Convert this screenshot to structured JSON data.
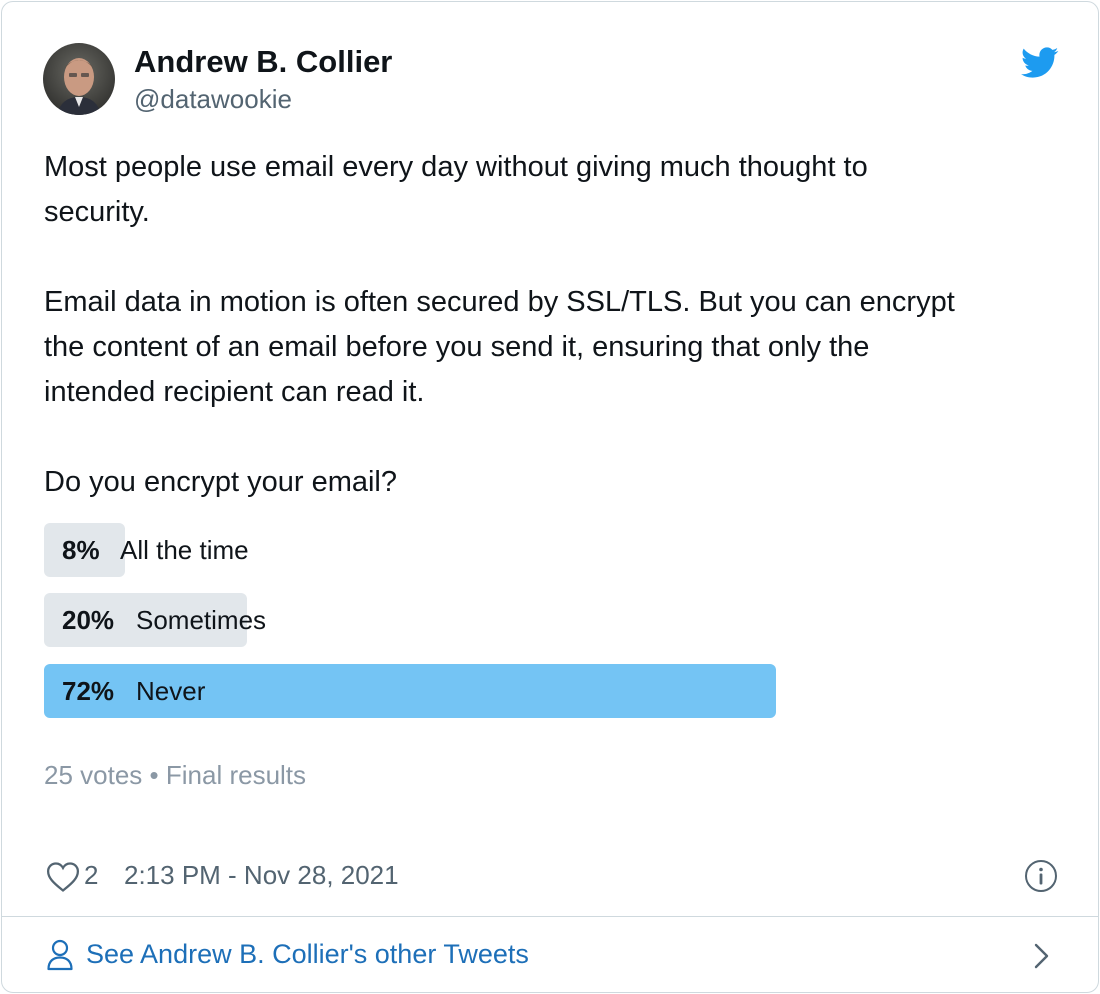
{
  "author": {
    "name": "Andrew B. Collier",
    "handle": "@datawookie"
  },
  "icons": {
    "brand": "twitter-bird-icon",
    "like": "heart-icon",
    "info": "info-icon",
    "profile": "person-icon",
    "more": "chevron-right-icon"
  },
  "colors": {
    "brand": "#1d9bf0",
    "winner_bar": "#74c4f4",
    "bar": "#e2e7eb",
    "link": "#1d6fb8"
  },
  "tweet": {
    "paragraphs": [
      [
        "Most people use email every day without giving much thought to",
        "security."
      ],
      [
        "Email data in motion is often secured by SSL/TLS. But you can encrypt",
        "the content of an email before you send it, ensuring that only the",
        "intended recipient can read it."
      ],
      [
        "Do you encrypt your email?"
      ]
    ]
  },
  "poll": {
    "options": [
      {
        "percent_label": "8%",
        "percent": 8,
        "label": "All the time",
        "winner": false
      },
      {
        "percent_label": "20%",
        "percent": 20,
        "label": "Sometimes",
        "winner": false
      },
      {
        "percent_label": "72%",
        "percent": 72,
        "label": "Never",
        "winner": true
      }
    ],
    "votes": "25 votes",
    "separator": "•",
    "status": "Final results"
  },
  "footer": {
    "like_count": "2",
    "timestamp": "2:13 PM - Nov 28, 2021"
  },
  "more_tweets": {
    "label": "See Andrew B. Collier's other Tweets"
  }
}
